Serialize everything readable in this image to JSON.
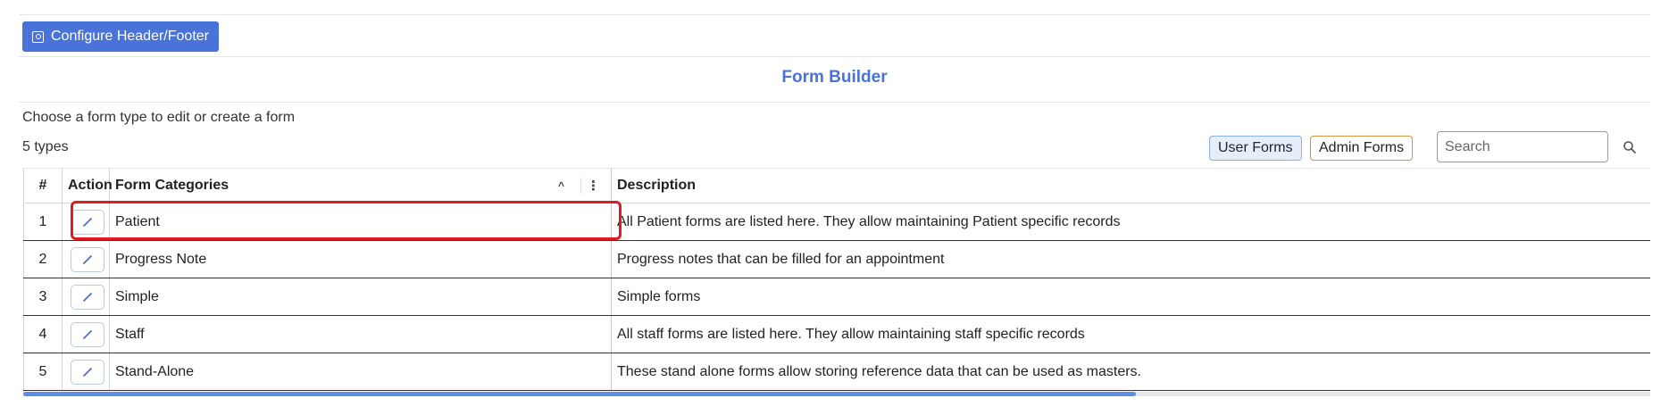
{
  "toolbar": {
    "config_label": "Configure Header/Footer"
  },
  "page": {
    "title": "Form Builder",
    "subtitle": "Choose a form type to edit or create a form",
    "count": "5 types"
  },
  "filters": {
    "user_forms": "User Forms",
    "admin_forms": "Admin Forms"
  },
  "search": {
    "placeholder": "Search",
    "value": ""
  },
  "table": {
    "headers": {
      "num": "#",
      "action": "Action",
      "category": "Form Categories",
      "description": "Description"
    },
    "rows": [
      {
        "num": "1",
        "category": "Patient",
        "description": "All Patient forms are listed here. They allow maintaining Patient specific records"
      },
      {
        "num": "2",
        "category": "Progress Note",
        "description": "Progress notes that can be filled for an appointment"
      },
      {
        "num": "3",
        "category": "Simple",
        "description": "Simple forms"
      },
      {
        "num": "4",
        "category": "Staff",
        "description": "All staff forms are listed here. They allow maintaining staff specific records"
      },
      {
        "num": "5",
        "category": "Stand-Alone",
        "description": "These stand alone forms allow storing reference data that can be used as masters."
      }
    ]
  },
  "colors": {
    "accent": "#4a73d9",
    "highlight": "#e01b24",
    "admin_border": "#d4973a"
  },
  "icons": {
    "config": "settings-box-icon",
    "edit": "pencil-icon",
    "search": "search-icon",
    "sort": "chevron-up-icon",
    "menu": "kebab-menu-icon"
  }
}
